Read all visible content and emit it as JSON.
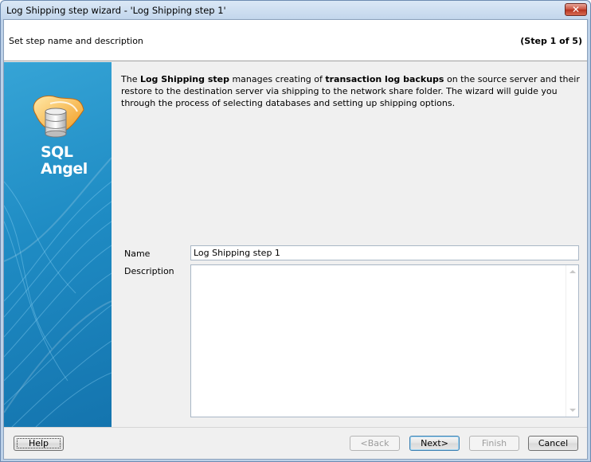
{
  "window": {
    "title": "Log Shipping step wizard - 'Log Shipping step 1'",
    "close_glyph": "✕"
  },
  "header": {
    "subtitle": "Set step name and description",
    "step_indicator": "(Step 1 of 5)"
  },
  "sidebar": {
    "logo_line1": "SQL",
    "logo_line2": "Angel",
    "logo_icon": "winged-database-icon"
  },
  "intro": {
    "part1": "The ",
    "bold1": "Log Shipping step",
    "part2": " manages creating of ",
    "bold2": "transaction log backups",
    "part3": " on the source server and their restore to the destination server via shipping to the network share folder. The wizard will guide you through the process of selecting databases and setting up shipping options."
  },
  "form": {
    "name_label": "Name",
    "name_value": "Log Shipping step 1",
    "description_label": "Description",
    "description_value": ""
  },
  "buttons": {
    "help": "Help",
    "back": "<Back",
    "next": "Next>",
    "finish": "Finish",
    "cancel": "Cancel"
  },
  "colors": {
    "sidebar_gradient_top": "#36a4d6",
    "sidebar_gradient_bottom": "#1474ae",
    "close_button": "#c9503c"
  }
}
